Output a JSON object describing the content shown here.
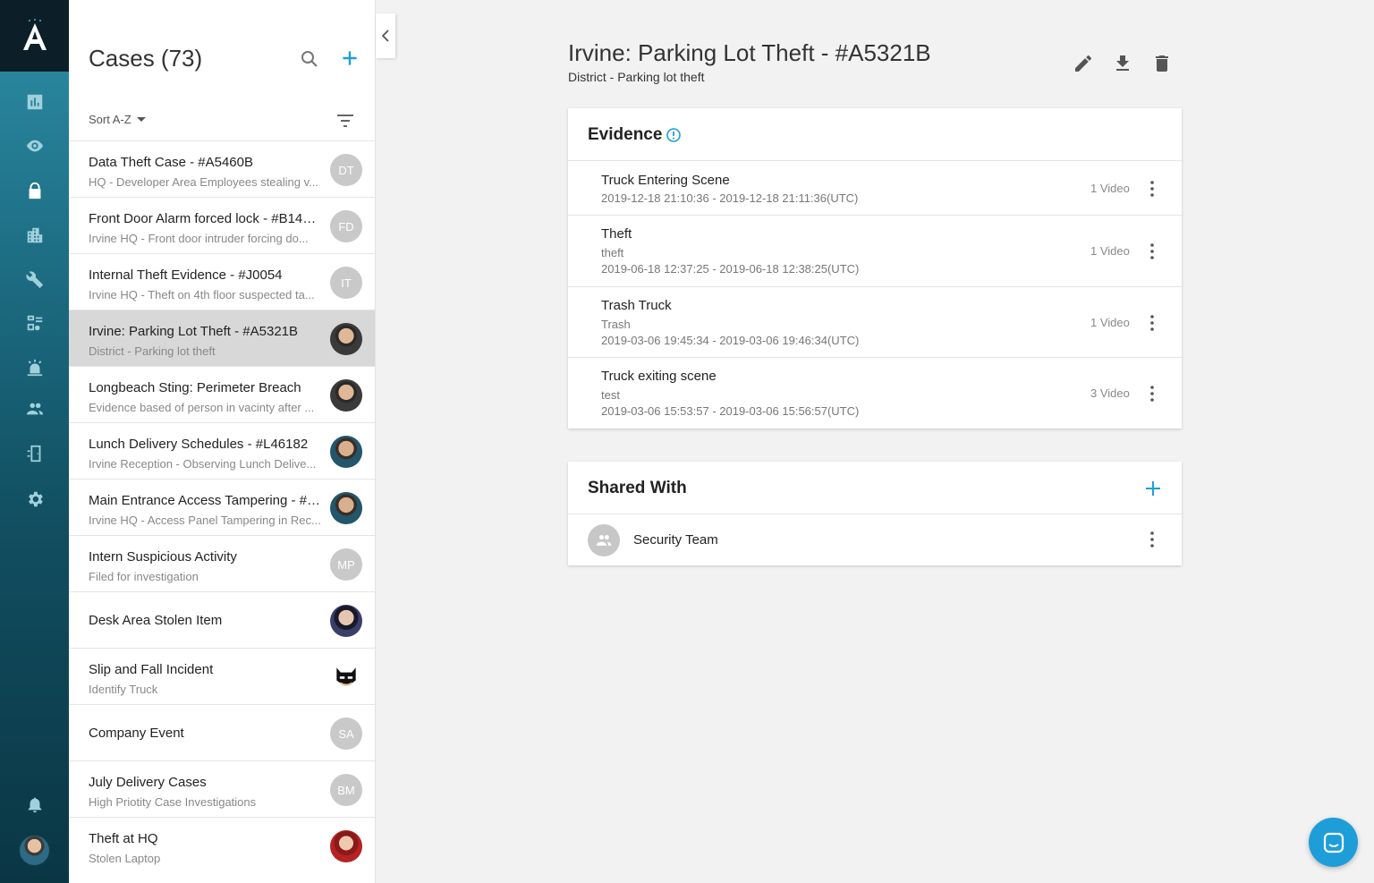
{
  "list": {
    "title": "Cases (73)",
    "sort_label": "Sort A-Z",
    "cases": [
      {
        "title": "Data Theft Case - #A5460B",
        "sub": "HQ - Developer Area Employees stealing v...",
        "avatar": "DT"
      },
      {
        "title": "Front Door Alarm forced lock - #B143...",
        "sub": "Irvine HQ - Front door intruder forcing do...",
        "avatar": "FD"
      },
      {
        "title": "Internal Theft Evidence - #J0054",
        "sub": "Irvine HQ - Theft on 4th floor suspected ta...",
        "avatar": "IT"
      },
      {
        "title": "Irvine: Parking Lot Theft - #A5321B",
        "sub": "District - Parking lot theft",
        "avatar": ""
      },
      {
        "title": "Longbeach Sting: Perimeter Breach",
        "sub": "Evidence based of person in vacinty after ...",
        "avatar": ""
      },
      {
        "title": "Lunch Delivery Schedules - #L46182",
        "sub": "Irvine Reception - Observing Lunch Delive...",
        "avatar": ""
      },
      {
        "title": "Main Entrance Access Tampering - #A...",
        "sub": "Irvine HQ - Access Panel Tampering in Rec...",
        "avatar": ""
      },
      {
        "title": "Intern Suspicious Activity",
        "sub": "Filed for investigation",
        "avatar": "MP"
      },
      {
        "title": "Desk Area Stolen Item",
        "sub": "",
        "avatar": ""
      },
      {
        "title": "Slip and Fall Incident",
        "sub": "Identify Truck",
        "avatar": ""
      },
      {
        "title": "Company Event",
        "sub": "",
        "avatar": "SA"
      },
      {
        "title": "July Delivery Cases",
        "sub": "High Priotity Case Investigations",
        "avatar": "BM"
      },
      {
        "title": "Theft at HQ",
        "sub": "Stolen Laptop",
        "avatar": ""
      }
    ]
  },
  "main": {
    "title": "Irvine: Parking Lot Theft - #A5321B",
    "subtitle": "District - Parking lot theft",
    "evidence": {
      "heading": "Evidence",
      "items": [
        {
          "title": "Truck Entering Scene",
          "desc": "",
          "time": "2019-12-18 21:10:36 - 2019-12-18 21:11:36(UTC)",
          "count": "1 Video"
        },
        {
          "title": "Theft",
          "desc": "theft",
          "time": "2019-06-18 12:37:25 - 2019-06-18 12:38:25(UTC)",
          "count": "1 Video"
        },
        {
          "title": "Trash Truck",
          "desc": "Trash",
          "time": "2019-03-06 19:45:34 - 2019-03-06 19:46:34(UTC)",
          "count": "1 Video"
        },
        {
          "title": "Truck exiting scene",
          "desc": "test",
          "time": "2019-03-06 15:53:57 - 2019-03-06 15:56:57(UTC)",
          "count": "3 Video"
        }
      ]
    },
    "shared": {
      "heading": "Shared With",
      "items": [
        {
          "name": "Security Team"
        }
      ]
    }
  },
  "colors": {
    "accent": "#1e9ed9",
    "selected_row": "#d8d8d8"
  }
}
